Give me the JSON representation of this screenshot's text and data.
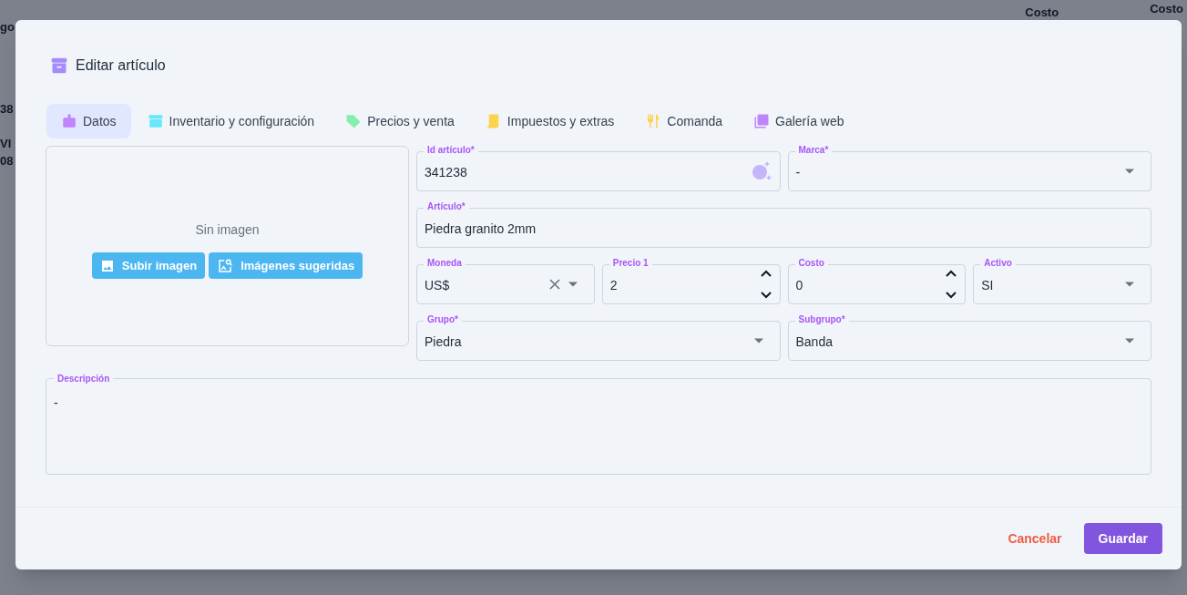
{
  "background": {
    "left_cells": [
      "go",
      "38",
      "VI",
      "08"
    ],
    "right_headers": [
      "Costo",
      "Costo"
    ]
  },
  "dialog": {
    "title": "Editar artículo"
  },
  "tabs": [
    {
      "label": "Datos",
      "color": "#c084fc",
      "selected": true
    },
    {
      "label": "Inventario y configuración",
      "color": "#67e8f9",
      "selected": false
    },
    {
      "label": "Precios y venta",
      "color": "#86efac",
      "selected": false
    },
    {
      "label": "Impuestos y extras",
      "color": "#fcd34d",
      "selected": false
    },
    {
      "label": "Comanda",
      "color": "#fcd34d",
      "selected": false
    },
    {
      "label": "Galería web",
      "color": "#c084fc",
      "selected": false
    }
  ],
  "image_panel": {
    "empty_text": "Sin imagen",
    "buttons": [
      {
        "label": "Subir imagen"
      },
      {
        "label": "Imágenes sugeridas"
      }
    ]
  },
  "field_rows": [
    [
      {
        "label": "Id artículo*",
        "value": "341238",
        "kind": "text"
      },
      {
        "label": "Marca*",
        "value": "-",
        "kind": "select"
      }
    ],
    [
      {
        "label": "Artículo*",
        "value": "Piedra granito 2mm",
        "kind": "text"
      }
    ],
    [
      {
        "label": "Moneda",
        "value": "US$",
        "kind": "select",
        "clearable": true
      },
      {
        "label": "Precio 1",
        "value": "2",
        "kind": "number"
      },
      {
        "label": "Costo",
        "value": "0",
        "kind": "number"
      },
      {
        "label": "Activo",
        "value": "SI",
        "kind": "select"
      }
    ],
    [
      {
        "label": "Grupo*",
        "value": "Piedra",
        "kind": "select"
      },
      {
        "label": "Subgrupo*",
        "value": "Banda",
        "kind": "select"
      }
    ]
  ],
  "description": {
    "label": "Descripción",
    "value": "-"
  },
  "footer": {
    "cancel": "Cancelar",
    "save": "Guardar"
  }
}
